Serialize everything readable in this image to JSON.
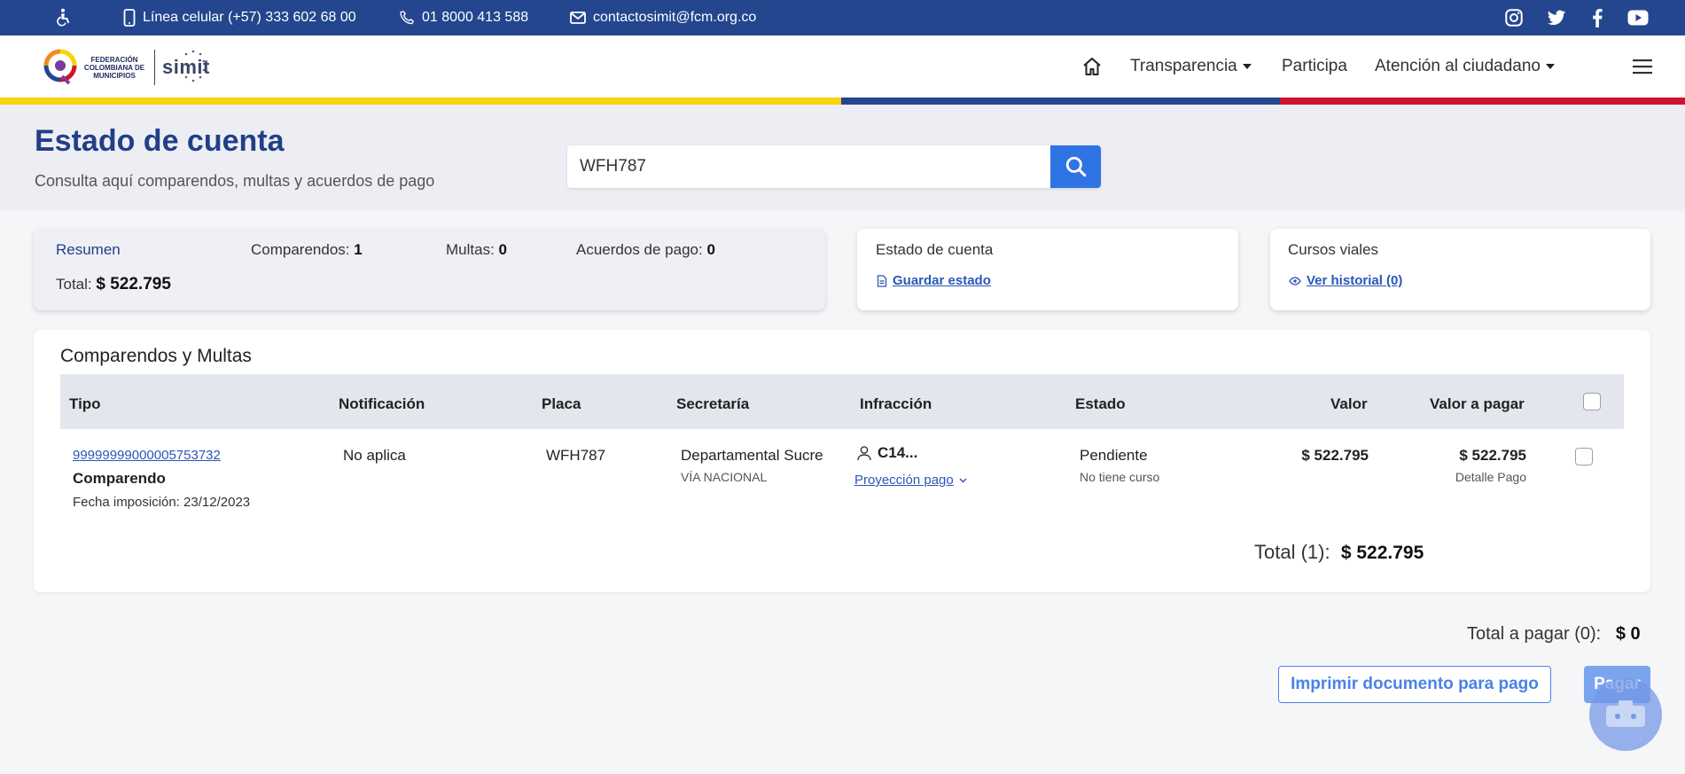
{
  "topbar": {
    "phone_mobile": "Línea celular (+57) 333 602 68 00",
    "phone_landline": "01 8000 413 588",
    "email": "contactosimit@fcm.org.co",
    "social": [
      "instagram-icon",
      "twitter-icon",
      "facebook-icon",
      "youtube-icon"
    ]
  },
  "header": {
    "logo_fcm": "FEDERACIÓN COLOMBIANA DE MUNICIPIOS",
    "logo_simit": "simit",
    "nav": {
      "transparencia": "Transparencia",
      "participa": "Participa",
      "atencion": "Atención al ciudadano"
    }
  },
  "colors": {
    "navy": "#23468f",
    "yellow": "#f7d30a",
    "blue": "#23468f",
    "red": "#d0122d",
    "accent": "#2f74e4"
  },
  "page": {
    "title": "Estado de cuenta",
    "subtitle": "Consulta aquí comparendos, multas y acuerdos de pago",
    "search_value": "WFH787"
  },
  "summary": {
    "label": "Resumen",
    "comparendos_label": "Comparendos:",
    "comparendos_value": "1",
    "multas_label": "Multas:",
    "multas_value": "0",
    "acuerdos_label": "Acuerdos de pago:",
    "acuerdos_value": "0",
    "total_label": "Total:",
    "total_value": "$ 522.795"
  },
  "estado_card": {
    "title": "Estado de cuenta",
    "link": "Guardar estado"
  },
  "cursos_card": {
    "title": "Cursos viales",
    "link": "Ver historial (0)"
  },
  "table": {
    "title": "Comparendos y Multas",
    "headers": {
      "tipo": "Tipo",
      "notificacion": "Notificación",
      "placa": "Placa",
      "secretaria": "Secretaría",
      "infraccion": "Infracción",
      "estado": "Estado",
      "valor": "Valor",
      "valor_pagar": "Valor a pagar"
    },
    "rows": [
      {
        "numero": "99999999000005753732",
        "tipo": "Comparendo",
        "fecha": "Fecha imposición: 23/12/2023",
        "notificacion": "No aplica",
        "placa": "WFH787",
        "secretaria": "Departamental Sucre",
        "via": "VÍA NACIONAL",
        "infraccion": "C14...",
        "proyeccion": "Proyección pago",
        "estado": "Pendiente",
        "curso": "No tiene curso",
        "valor": "$ 522.795",
        "valor_pagar": "$ 522.795",
        "detalle": "Detalle Pago"
      }
    ],
    "total_label": "Total (1):",
    "total_value": "$ 522.795"
  },
  "footer": {
    "total_pagar_label": "Total a pagar (0):",
    "total_pagar_value": "$ 0",
    "print_button": "Imprimir documento para pago",
    "pay_button": "Pagar"
  }
}
